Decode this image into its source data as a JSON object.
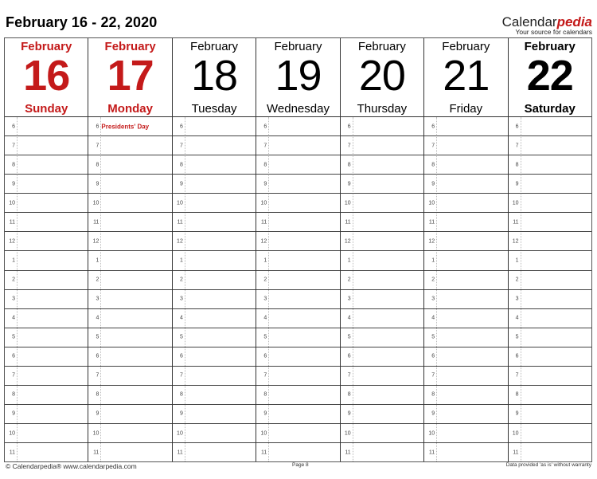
{
  "title": "February 16 - 22, 2020",
  "brand": {
    "name_plain": "Calendar",
    "name_accent": "pedia",
    "tagline": "Your source for calendars",
    "accent_color": "#c41a1a"
  },
  "days": [
    {
      "month": "February",
      "day": "16",
      "weekday": "Sunday",
      "style": "red"
    },
    {
      "month": "February",
      "day": "17",
      "weekday": "Monday",
      "style": "red"
    },
    {
      "month": "February",
      "day": "18",
      "weekday": "Tuesday",
      "style": "normal"
    },
    {
      "month": "February",
      "day": "19",
      "weekday": "Wednesday",
      "style": "normal"
    },
    {
      "month": "February",
      "day": "20",
      "weekday": "Thursday",
      "style": "normal"
    },
    {
      "month": "February",
      "day": "21",
      "weekday": "Friday",
      "style": "normal"
    },
    {
      "month": "February",
      "day": "22",
      "weekday": "Saturday",
      "style": "bold"
    }
  ],
  "hours": [
    "6",
    "7",
    "8",
    "9",
    "10",
    "11",
    "12",
    "1",
    "2",
    "3",
    "4",
    "5",
    "6",
    "7",
    "8",
    "9",
    "10",
    "11"
  ],
  "events": [
    {
      "day_index": 1,
      "hour_index": 0,
      "label": "Presidents' Day"
    }
  ],
  "footer": {
    "left": "© Calendarpedia®   www.calendarpedia.com",
    "center": "Page 8",
    "right": "Data provided 'as is' without warranty"
  }
}
